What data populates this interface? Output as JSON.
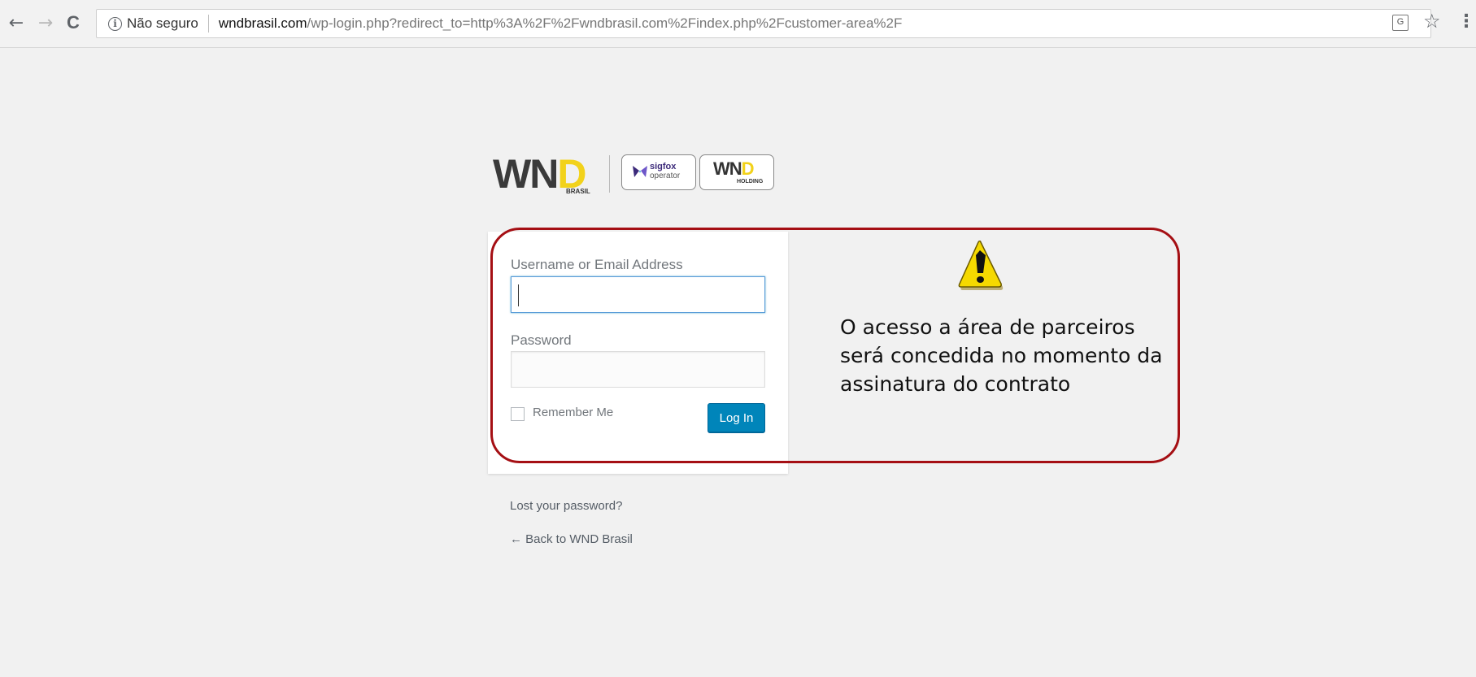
{
  "browser": {
    "back_glyph": "←",
    "forward_glyph": "→",
    "reload_glyph": "C",
    "info_glyph": "i",
    "security_text": "Não seguro",
    "url_host": "wndbrasil.com",
    "url_rest": "/wp-login.php?redirect_to=http%3A%2F%2Fwndbrasil.com%2Findex.php%2Fcustomer-area%2F",
    "translate_glyph": "G",
    "star_glyph": "☆",
    "menu_glyph": "⋮"
  },
  "logos": {
    "wnd_main": "WN",
    "wnd_d": "D",
    "wnd_brasil": "BRASIL",
    "sigfox_name": "sigfox",
    "sigfox_sub": "operator",
    "holding_wnd": "WN",
    "holding_d": "D",
    "holding_sub": "HOLDING"
  },
  "login": {
    "username_label": "Username or Email Address",
    "username_value": "",
    "password_label": "Password",
    "password_value": "",
    "remember_label": "Remember Me",
    "remember_checked": false,
    "submit_label": "Log In"
  },
  "links": {
    "lost_password": "Lost your password?",
    "back_to_site": "← Back to WND Brasil"
  },
  "annotation": {
    "text": "O acesso a área de parceiros será concedida no momento da assinatura do contrato",
    "border_color": "#a50f14",
    "warning_icon": "warning-triangle-icon"
  },
  "colors": {
    "button": "#0085ba",
    "focus": "#5b9dd9",
    "wnd_yellow": "#f2d21b"
  }
}
